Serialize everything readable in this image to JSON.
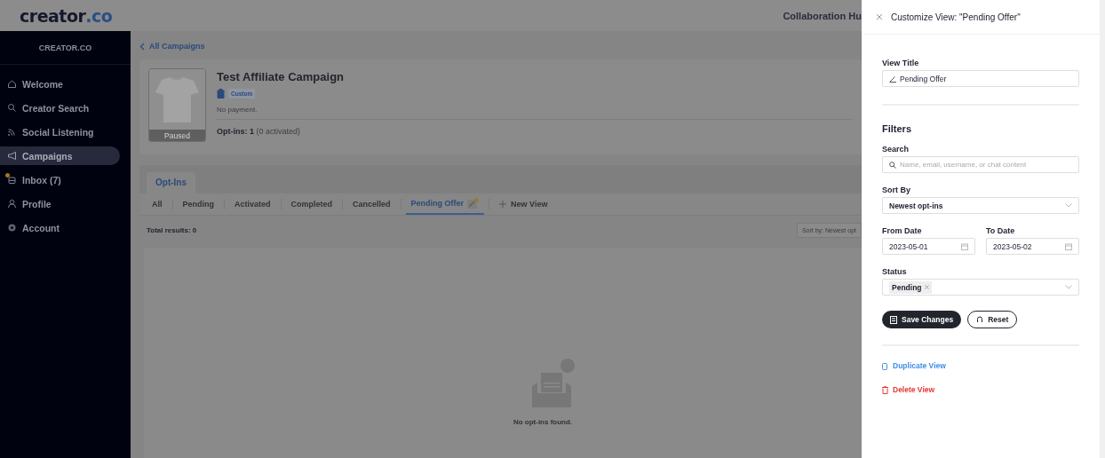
{
  "topbar": {
    "logo": {
      "text": "creator",
      "accent": ".co"
    },
    "nav_link": "Collaboration Hu"
  },
  "sidebar": {
    "brand": "CREATOR.CO",
    "items": [
      {
        "label": "Welcome",
        "selected": false,
        "notify": false
      },
      {
        "label": "Creator Search",
        "selected": false,
        "notify": false
      },
      {
        "label": "Social Listening",
        "selected": false,
        "notify": false
      },
      {
        "label": "Campaigns",
        "selected": true,
        "notify": false
      },
      {
        "label": "Inbox (7)",
        "selected": false,
        "notify": true
      },
      {
        "label": "Profile",
        "selected": false,
        "notify": false
      },
      {
        "label": "Account",
        "selected": false,
        "notify": false
      }
    ]
  },
  "main": {
    "breadcrumb": "All Campaigns",
    "campaign": {
      "title": "Test Affiliate Campaign",
      "tag": "Custom",
      "payment": "No payment.",
      "status": "Paused",
      "optins": "Opt-ins: 1",
      "optins_note": "(0 activated)"
    },
    "section_tab": "Opt-Ins",
    "view_tabs": [
      {
        "label": "All",
        "selected": false,
        "editable": false
      },
      {
        "label": "Pending",
        "selected": false,
        "editable": false
      },
      {
        "label": "Activated",
        "selected": false,
        "editable": false
      },
      {
        "label": "Completed",
        "selected": false,
        "editable": false
      },
      {
        "label": "Cancelled",
        "selected": false,
        "editable": false
      },
      {
        "label": "Pending Offer",
        "selected": true,
        "editable": true
      }
    ],
    "new_view": "New View",
    "total": "Total results: 0",
    "sort": "Sort by: Newest opt",
    "empty": "No opt-ins found."
  },
  "panel": {
    "title": "Customize View: \"Pending Offer\"",
    "view_title_label": "View Title",
    "view_title_value": "Pending Offer",
    "filters": "Filters",
    "search_label": "Search",
    "search_placeholder": "Name, email, username, or chat content",
    "sort_label": "Sort By",
    "sort_value": "Newest opt-ins",
    "from_label": "From Date",
    "from_value": "2023-05-01",
    "to_label": "To Date",
    "to_value": "2023-05-02",
    "status_label": "Status",
    "status_chips": [
      "Pending"
    ],
    "save": "Save Changes",
    "reset": "Reset",
    "duplicate": "Duplicate View",
    "delete": "Delete View"
  }
}
